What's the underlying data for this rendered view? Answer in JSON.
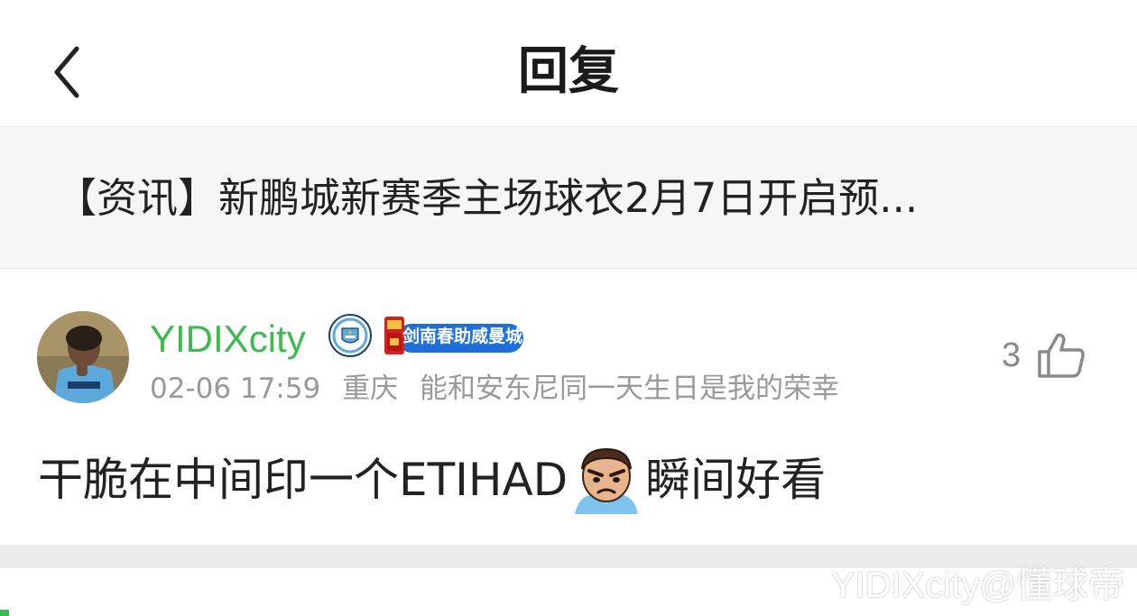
{
  "header": {
    "title": "回复",
    "back_icon": "chevron-left-icon"
  },
  "article": {
    "title": "【资讯】新鹏城新赛季主场球衣2月7日开启预..."
  },
  "reply": {
    "username": "YIDIXcity",
    "team_badge_icon": "manchester-city-badge-icon",
    "medal_text": "剑南春助威曼城",
    "time": "02-06 17:59",
    "location": "重庆",
    "signature": "能和安东尼同一天生日是我的荣幸",
    "like_count": "3",
    "like_icon": "thumbs-up-icon",
    "comment_before": "干脆在中间印一个ETIHAD",
    "comment_emoji": "angry-face-emoji",
    "comment_after": "瞬间好看"
  },
  "watermark": "YIDIXcity@懂球帝",
  "colors": {
    "username": "#3dbb4f",
    "meta": "#999999",
    "article_bg": "#f6f6f6",
    "medal_blue": "#1e6fd9",
    "divider": "#ebebeb"
  }
}
